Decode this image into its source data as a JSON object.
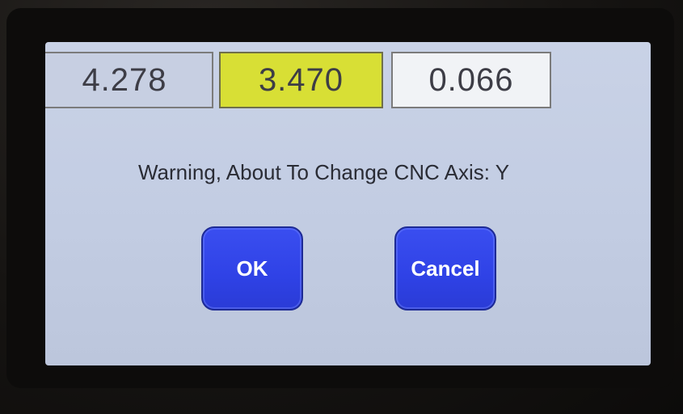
{
  "readouts": {
    "x_value": "4.278",
    "y_value": "3.470",
    "z_value": "0.066"
  },
  "dialog": {
    "message": "Warning, About To Change CNC Axis: Y",
    "ok_label": "OK",
    "cancel_label": "Cancel"
  },
  "colors": {
    "screen_background": "#c3cde3",
    "active_readout": "#d8df35",
    "button": "#2f42e6"
  }
}
